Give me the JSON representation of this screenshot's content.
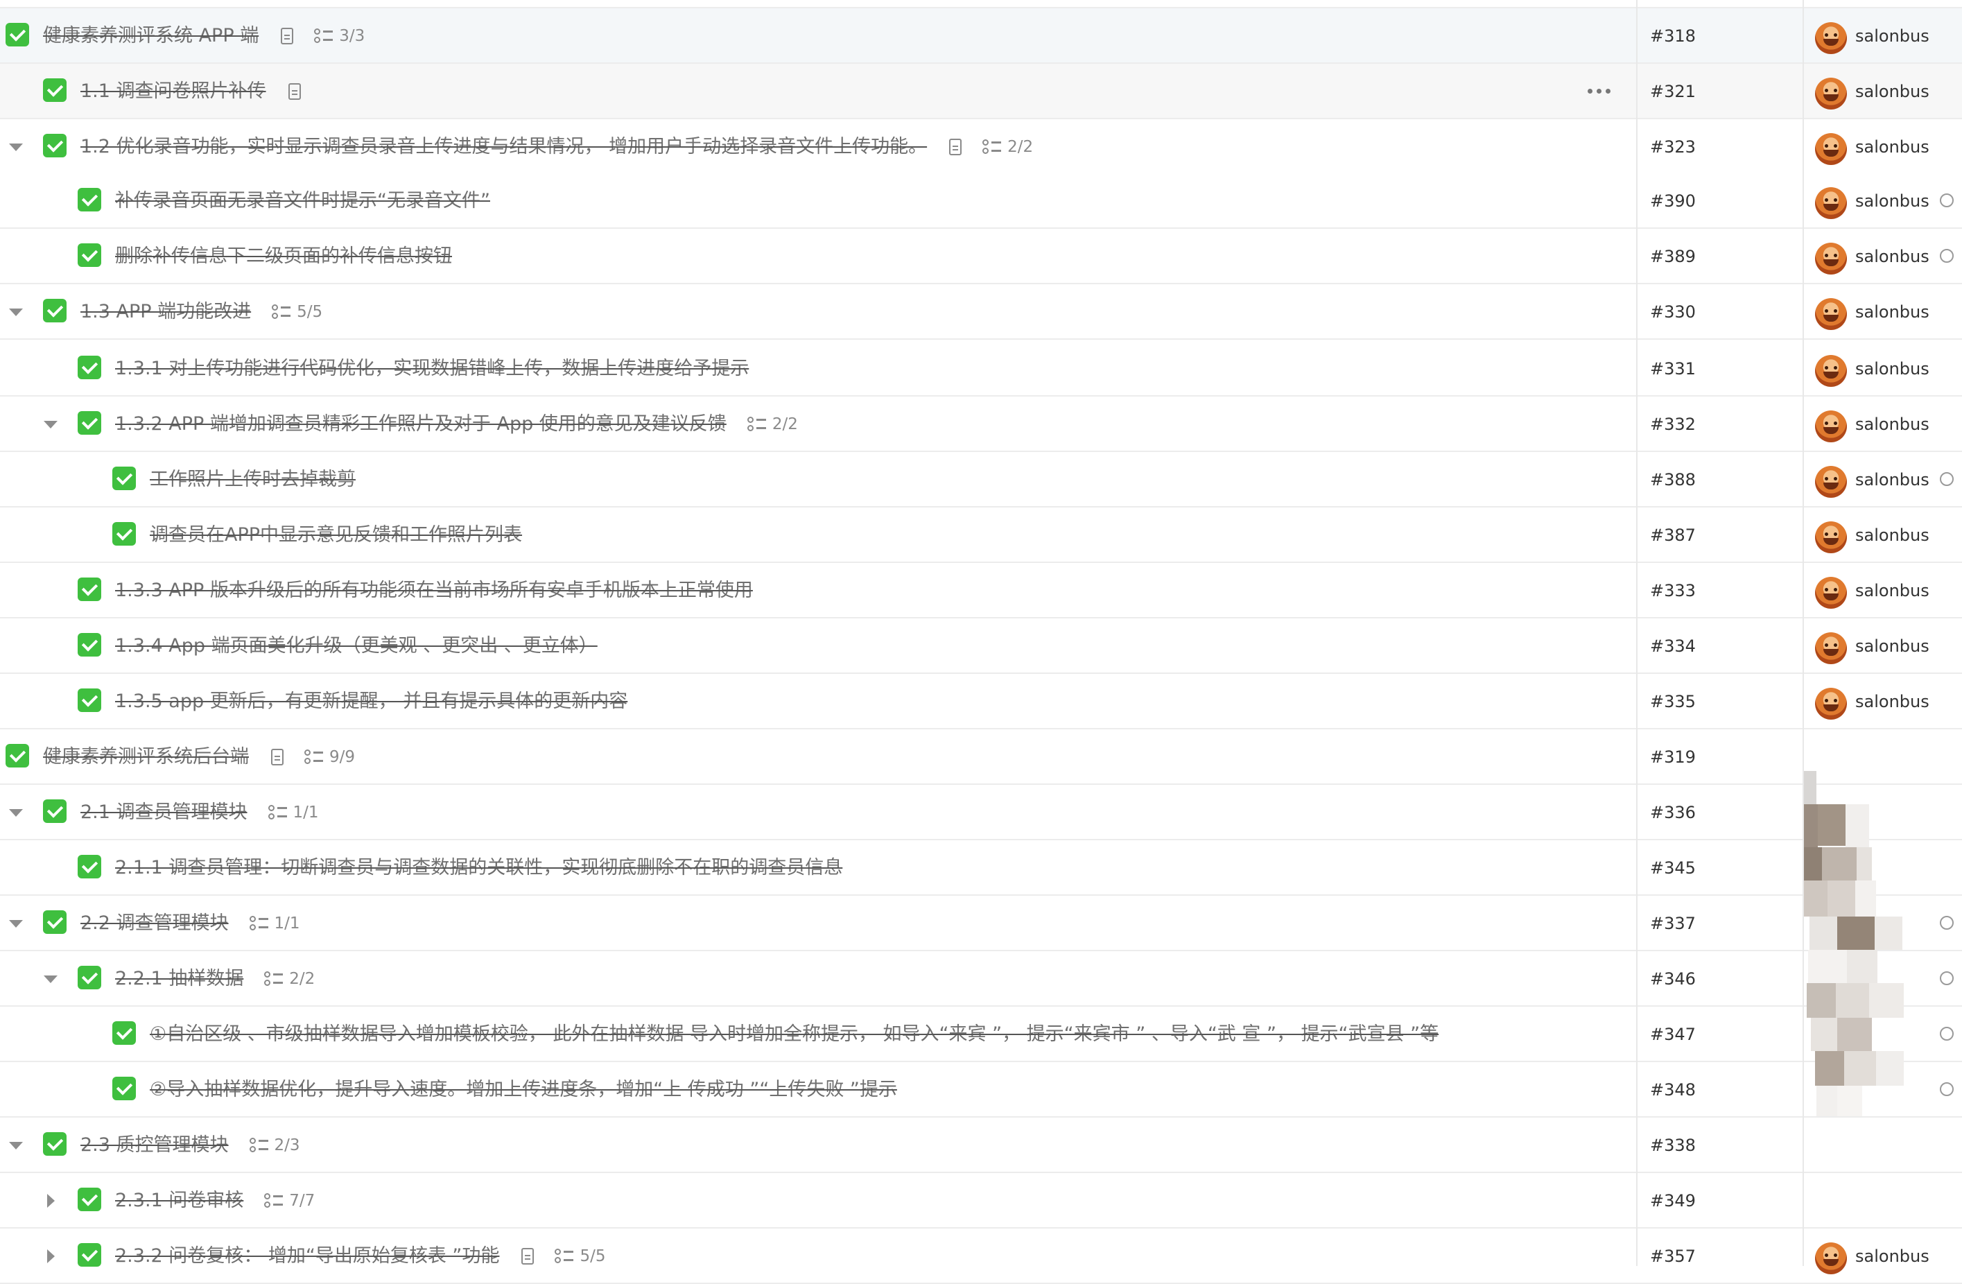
{
  "owner_name": "salonbus",
  "rows": [
    {
      "depth": 0,
      "toggle": "none",
      "title": "健康素养测评系统 APP 端",
      "doc": true,
      "sub": "3/3",
      "id": "#318",
      "owner": true,
      "status": false,
      "bg": "hl-top",
      "more": false
    },
    {
      "depth": 1,
      "toggle": "none",
      "title": "1.1 调查问卷照片补传",
      "doc": true,
      "sub": null,
      "id": "#321",
      "owner": true,
      "status": false,
      "bg": "hl",
      "more": true
    },
    {
      "depth": 1,
      "toggle": "down",
      "title": "1.2 优化录音功能，实时显示调查员录音上传进度与结果情况， 增加用户手动选择录音文件上传功能。",
      "doc": true,
      "sub": "2/2",
      "id": "#323",
      "owner": true,
      "status": false,
      "bg": "",
      "more": false
    },
    {
      "depth": 2,
      "toggle": "none",
      "title": "补传录音页面无录音文件时提示“无录音文件”",
      "doc": false,
      "sub": null,
      "id": "#390",
      "owner": true,
      "status": true,
      "bg": "",
      "more": false
    },
    {
      "depth": 2,
      "toggle": "none",
      "title": "删除补传信息下二级页面的补传信息按钮",
      "doc": false,
      "sub": null,
      "id": "#389",
      "owner": true,
      "status": true,
      "bg": "",
      "more": false
    },
    {
      "depth": 1,
      "toggle": "down",
      "title": "1.3 APP 端功能改进",
      "doc": false,
      "sub": "5/5",
      "id": "#330",
      "owner": true,
      "status": false,
      "bg": "",
      "more": false
    },
    {
      "depth": 2,
      "toggle": "none",
      "title": "1.3.1 对上传功能进行代码优化，实现数据错峰上传，数据上传进度给予提示",
      "doc": false,
      "sub": null,
      "id": "#331",
      "owner": true,
      "status": false,
      "bg": "",
      "more": false
    },
    {
      "depth": 2,
      "toggle": "down",
      "title": "1.3.2 APP 端增加调查员精彩工作照片及对于 App 使用的意见及建议反馈",
      "doc": false,
      "sub": "2/2",
      "id": "#332",
      "owner": true,
      "status": false,
      "bg": "",
      "more": false
    },
    {
      "depth": 3,
      "toggle": "none",
      "title": "工作照片上传时去掉裁剪",
      "doc": false,
      "sub": null,
      "id": "#388",
      "owner": true,
      "status": true,
      "bg": "",
      "more": false
    },
    {
      "depth": 3,
      "toggle": "none",
      "title": "调查员在APP中显示意见反馈和工作照片列表",
      "doc": false,
      "sub": null,
      "id": "#387",
      "owner": true,
      "status": false,
      "bg": "",
      "more": false
    },
    {
      "depth": 2,
      "toggle": "none",
      "title": "1.3.3 APP 版本升级后的所有功能须在当前市场所有安卓手机版本上正常使用",
      "doc": false,
      "sub": null,
      "id": "#333",
      "owner": true,
      "status": false,
      "bg": "",
      "more": false
    },
    {
      "depth": 2,
      "toggle": "none",
      "title": "1.3.4 App 端页面美化升级（更美观 、更突出 、更立体）",
      "doc": false,
      "sub": null,
      "id": "#334",
      "owner": true,
      "status": false,
      "bg": "",
      "more": false
    },
    {
      "depth": 2,
      "toggle": "none",
      "title": "1.3.5 app 更新后，有更新提醒， 并且有提示具体的更新内容",
      "doc": false,
      "sub": null,
      "id": "#335",
      "owner": true,
      "status": false,
      "bg": "",
      "more": false
    },
    {
      "depth": 0,
      "toggle": "none",
      "title": "健康素养测评系统后台端",
      "doc": true,
      "sub": "9/9",
      "id": "#319",
      "owner": false,
      "status": false,
      "bg": "",
      "more": false
    },
    {
      "depth": 1,
      "toggle": "down",
      "title": "2.1 调查员管理模块",
      "doc": false,
      "sub": "1/1",
      "id": "#336",
      "owner": false,
      "status": false,
      "bg": "",
      "more": false
    },
    {
      "depth": 2,
      "toggle": "none",
      "title": "2.1.1 调查员管理：切断调查员与调查数据的关联性，实现彻底删除不在职的调查员信息",
      "doc": false,
      "sub": null,
      "id": "#345",
      "owner": false,
      "status": false,
      "bg": "",
      "more": false
    },
    {
      "depth": 1,
      "toggle": "down",
      "title": "2.2 调查管理模块",
      "doc": false,
      "sub": "1/1",
      "id": "#337",
      "owner": false,
      "status": true,
      "bg": "",
      "more": false
    },
    {
      "depth": 2,
      "toggle": "down",
      "title": "2.2.1 抽样数据",
      "doc": false,
      "sub": "2/2",
      "id": "#346",
      "owner": false,
      "status": true,
      "bg": "",
      "more": false
    },
    {
      "depth": 3,
      "toggle": "none",
      "title": "①自治区级 、市级抽样数据导入增加模板校验， 此外在抽样数据 导入时增加全称提示， 如导入“来宾 ”， 提示“来宾市 ” 、导入“武 宣 ”， 提示“武宣县 ”等",
      "doc": false,
      "sub": null,
      "id": "#347",
      "owner": false,
      "status": true,
      "bg": "",
      "more": false
    },
    {
      "depth": 3,
      "toggle": "none",
      "title": "②导入抽样数据优化，提升导入速度。增加上传进度条，增加“上 传成功 ”“上传失败 ”提示",
      "doc": false,
      "sub": null,
      "id": "#348",
      "owner": false,
      "status": true,
      "bg": "",
      "more": false
    },
    {
      "depth": 1,
      "toggle": "down",
      "title": "2.3 质控管理模块",
      "doc": false,
      "sub": "2/3",
      "id": "#338",
      "owner": false,
      "status": false,
      "bg": "",
      "more": false
    },
    {
      "depth": 2,
      "toggle": "right",
      "title": "2.3.1 问卷审核",
      "doc": false,
      "sub": "7/7",
      "id": "#349",
      "owner": false,
      "status": false,
      "bg": "",
      "more": false
    },
    {
      "depth": 2,
      "toggle": "right",
      "title": "2.3.2 问卷复核： 增加“导出原始复核表 ”功能",
      "doc": true,
      "sub": "5/5",
      "id": "#357",
      "owner": true,
      "status": false,
      "bg": "",
      "more": false
    }
  ],
  "colors": {
    "check": "#3fbf3f",
    "text": "#6f6f6f",
    "divider": "#ececec",
    "highlight": "#f4f7f9"
  }
}
